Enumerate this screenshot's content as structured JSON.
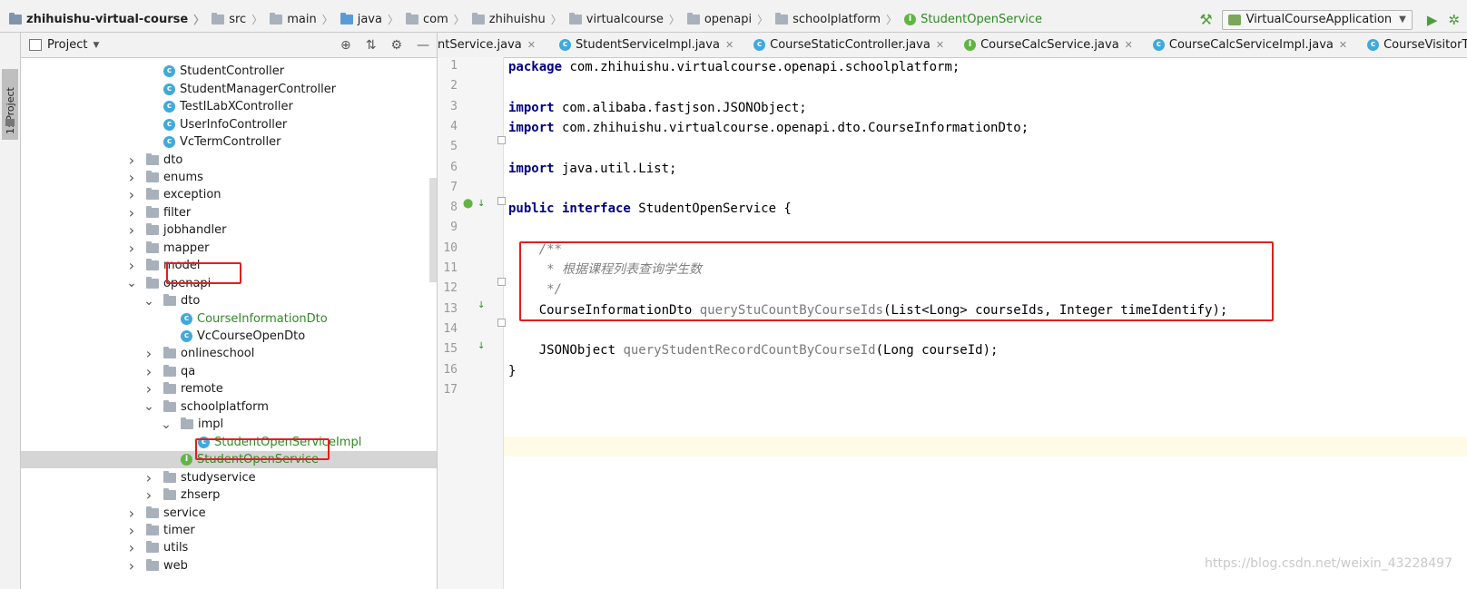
{
  "breadcrumb": [
    "zhihuishu-virtual-course",
    "src",
    "main",
    "java",
    "com",
    "zhihuishu",
    "virtualcourse",
    "openapi",
    "schoolplatform",
    "StudentOpenService"
  ],
  "run_config": "VirtualCourseApplication",
  "left_strip": "1: Project",
  "project_panel": {
    "title": "Project"
  },
  "tree": [
    {
      "label": "StudentController",
      "icon": "class",
      "indent": 2
    },
    {
      "label": "StudentManagerController",
      "icon": "class",
      "indent": 2
    },
    {
      "label": "TestILabXController",
      "icon": "class",
      "indent": 2
    },
    {
      "label": "UserInfoController",
      "icon": "class",
      "indent": 2
    },
    {
      "label": "VcTermController",
      "icon": "class",
      "indent": 2
    },
    {
      "label": "dto",
      "icon": "folder",
      "indent": 1,
      "arrow": "right"
    },
    {
      "label": "enums",
      "icon": "folder",
      "indent": 1,
      "arrow": "right"
    },
    {
      "label": "exception",
      "icon": "folder",
      "indent": 1,
      "arrow": "right"
    },
    {
      "label": "filter",
      "icon": "folder",
      "indent": 1,
      "arrow": "right"
    },
    {
      "label": "jobhandler",
      "icon": "folder",
      "indent": 1,
      "arrow": "right"
    },
    {
      "label": "mapper",
      "icon": "folder",
      "indent": 1,
      "arrow": "right"
    },
    {
      "label": "model",
      "icon": "folder",
      "indent": 1,
      "arrow": "right"
    },
    {
      "label": "openapi",
      "icon": "folder",
      "indent": 1,
      "arrow": "down"
    },
    {
      "label": "dto",
      "icon": "folder",
      "indent": 2,
      "arrow": "down"
    },
    {
      "label": "CourseInformationDto",
      "icon": "class",
      "indent": 3,
      "green": true
    },
    {
      "label": "VcCourseOpenDto",
      "icon": "class",
      "indent": 3
    },
    {
      "label": "onlineschool",
      "icon": "folder",
      "indent": 2,
      "arrow": "right"
    },
    {
      "label": "qa",
      "icon": "folder",
      "indent": 2,
      "arrow": "right"
    },
    {
      "label": "remote",
      "icon": "folder",
      "indent": 2,
      "arrow": "right"
    },
    {
      "label": "schoolplatform",
      "icon": "folder",
      "indent": 2,
      "arrow": "down"
    },
    {
      "label": "impl",
      "icon": "folder",
      "indent": 3,
      "arrow": "down"
    },
    {
      "label": "StudentOpenServiceImpl",
      "icon": "class",
      "indent": 4,
      "green": true
    },
    {
      "label": "StudentOpenService",
      "icon": "interface",
      "indent": 3,
      "green": true,
      "selected": true
    },
    {
      "label": "studyservice",
      "icon": "folder",
      "indent": 2,
      "arrow": "right"
    },
    {
      "label": "zhserp",
      "icon": "folder",
      "indent": 2,
      "arrow": "right"
    },
    {
      "label": "service",
      "icon": "folder",
      "indent": 1,
      "arrow": "right"
    },
    {
      "label": "timer",
      "icon": "folder",
      "indent": 1,
      "arrow": "right"
    },
    {
      "label": "utils",
      "icon": "folder",
      "indent": 1,
      "arrow": "right"
    },
    {
      "label": "web",
      "icon": "folder",
      "indent": 1,
      "arrow": "right"
    }
  ],
  "tabs": [
    {
      "label": "ntService.java",
      "icon": "none"
    },
    {
      "label": "StudentServiceImpl.java",
      "icon": "class"
    },
    {
      "label": "CourseStaticController.java",
      "icon": "class"
    },
    {
      "label": "CourseCalcService.java",
      "icon": "interface"
    },
    {
      "label": "CourseCalcServiceImpl.java",
      "icon": "class"
    },
    {
      "label": "CourseVisitorTotalCountDailyJobHand",
      "icon": "class"
    }
  ],
  "code": {
    "l1_kw": "package",
    "l1_rest": " com.zhihuishu.virtualcourse.openapi.schoolplatform;",
    "l3_kw": "import",
    "l3_rest": " com.alibaba.fastjson.JSONObject;",
    "l4_kw": "import",
    "l4_rest": " com.zhihuishu.virtualcourse.openapi.dto.CourseInformationDto;",
    "l6_kw": "import",
    "l6_rest": " java.util.List;",
    "l8_kw": "public interface",
    "l8_rest": " StudentOpenService {",
    "l10": "    /**",
    "l11": "     * 根据课程列表查询学生数",
    "l12": "     */",
    "l13_type": "    CourseInformationDto ",
    "l13_method": "queryStuCountByCourseIds",
    "l13_rest": "(List<Long> courseIds, Integer timeIdentify);",
    "l15_type": "    JSONObject ",
    "l15_method": "queryStudentRecordCountByCourseId",
    "l15_rest": "(Long courseId);",
    "l16": "}"
  },
  "line_numbers": [
    "1",
    "2",
    "3",
    "4",
    "5",
    "6",
    "7",
    "8",
    "9",
    "10",
    "11",
    "12",
    "13",
    "14",
    "15",
    "16",
    "17"
  ],
  "watermark": "https://blog.csdn.net/weixin_43228497"
}
